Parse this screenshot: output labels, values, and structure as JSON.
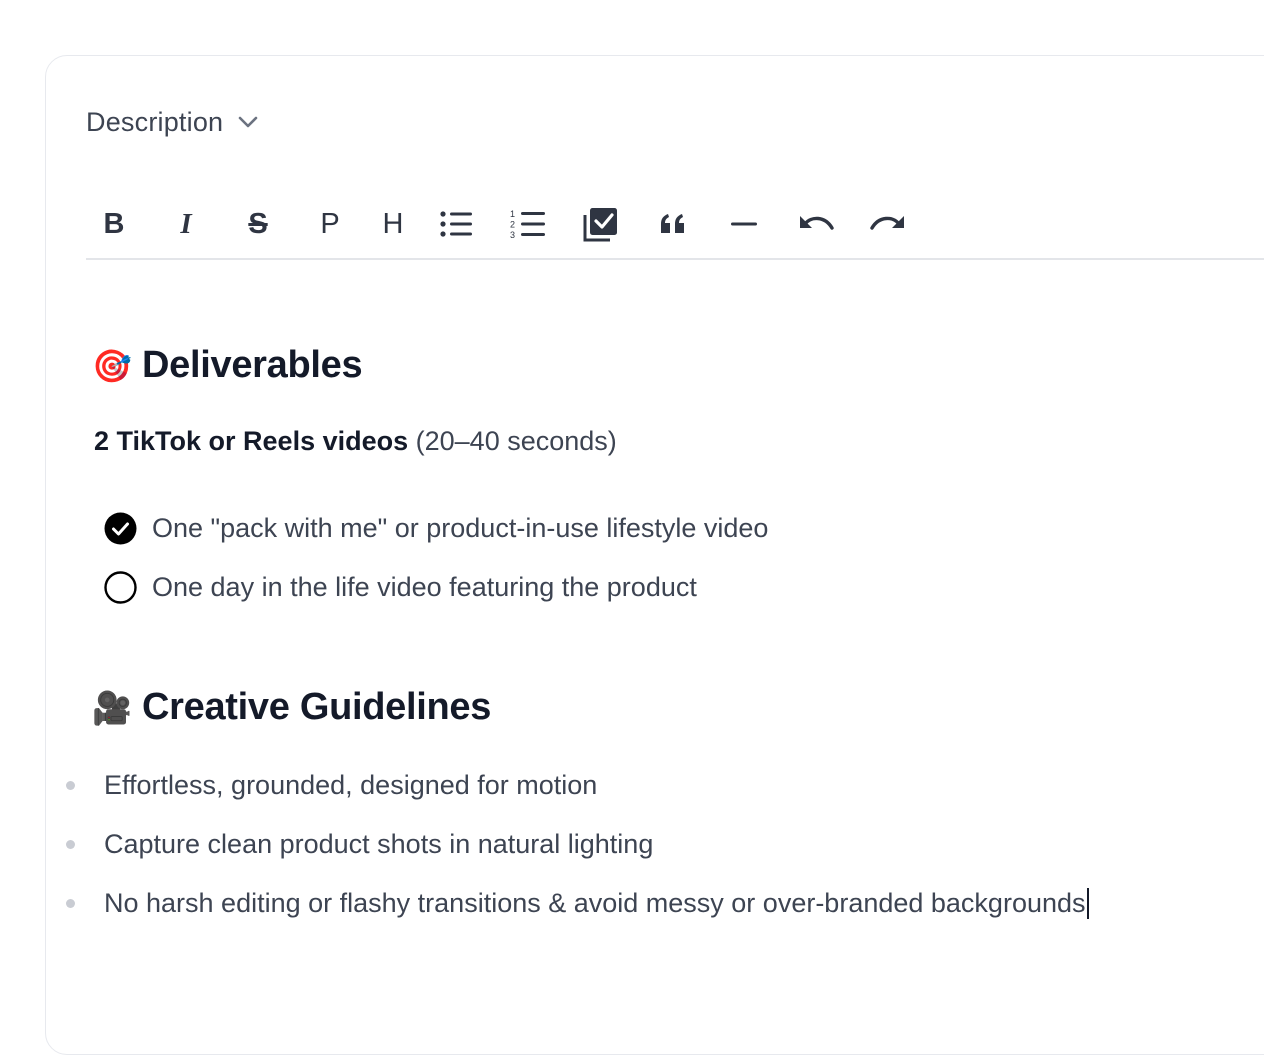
{
  "section": {
    "title": "Description"
  },
  "toolbar": {
    "bold": "B",
    "italic": "I",
    "strike": "S",
    "paragraph": "P",
    "heading": "H"
  },
  "editor": {
    "deliverables": {
      "emoji": "🎯",
      "title": "Deliverables"
    },
    "summary": {
      "bold": "2 TikTok or Reels videos",
      "rest": " (20–40 seconds)"
    },
    "tasks": [
      {
        "label": "One \"pack with me\" or product-in-use lifestyle video",
        "checked": true
      },
      {
        "label": "One day in the life video featuring the product",
        "checked": false
      }
    ],
    "guidelines": {
      "emoji": "🎥",
      "title": "Creative Guidelines"
    },
    "bullets": [
      "Effortless, grounded, designed for motion",
      "Capture clean product shots in natural lighting",
      "No harsh editing or flashy transitions & avoid messy or over-branded backgrounds"
    ]
  }
}
